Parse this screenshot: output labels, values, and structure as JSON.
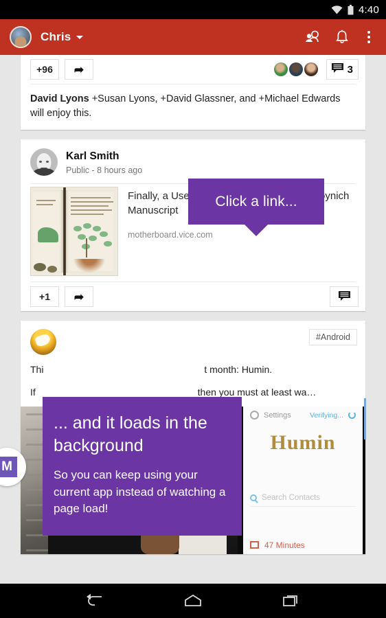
{
  "status_bar": {
    "time": "4:40",
    "wifi_icon": "wifi-icon",
    "battery_icon": "battery-icon"
  },
  "action_bar": {
    "account_name": "Chris",
    "avatar": "user-avatar",
    "caret": "chevron-down-icon",
    "icons": [
      "people-icon",
      "notifications-bell-icon",
      "overflow-menu-icon"
    ]
  },
  "cards": {
    "card1": {
      "plus_one_label": "+96",
      "share_icon": "share-icon",
      "comment_icon": "comment-icon",
      "comment_count": "3",
      "author": "David Lyons",
      "text": " +Susan Lyons, +David Glassner, and +Michael Edwards will enjoy this."
    },
    "card2": {
      "author": "Karl Smith",
      "meta": "Public - 8 hours ago",
      "link_title": "Finally, a Use for Big Data: Cracking the Voynich Manuscript",
      "link_host": "motherboard.vice.com",
      "thumbnail": "voynich-manuscript-thumbnail",
      "plus_one_label": "+1",
      "share_icon": "share-icon",
      "comment_icon": "comment-icon"
    },
    "card3": {
      "tag": "#Android",
      "body_line1_prefix": "Thi",
      "body_line1_suffix": "t month: Humin.",
      "body_line2_prefix": "If",
      "body_line2_suffix": "then you must at least wa…",
      "video": {
        "play_icon": "play-button-icon",
        "phone_app_name": "Humin",
        "phone_settings_label": "Settings",
        "phone_status_label": "Verifying...",
        "phone_search_placeholder": "Search Contacts",
        "phone_footer_label": "47 Minutes"
      },
      "badge_letter": "M"
    }
  },
  "callouts": {
    "first": {
      "text": "Click a link..."
    },
    "second": {
      "title": "... and it loads in the background",
      "subtitle": "So you can keep using your current app instead of watching a page load!"
    }
  },
  "nav_bar": {
    "back_icon": "back-icon",
    "home_icon": "home-icon",
    "recents_icon": "recents-icon"
  },
  "colors": {
    "action_bar_red": "#bf3222",
    "callout_purple": "#6b35a3",
    "page_background": "#e6e6e6",
    "card_white": "#ffffff"
  }
}
